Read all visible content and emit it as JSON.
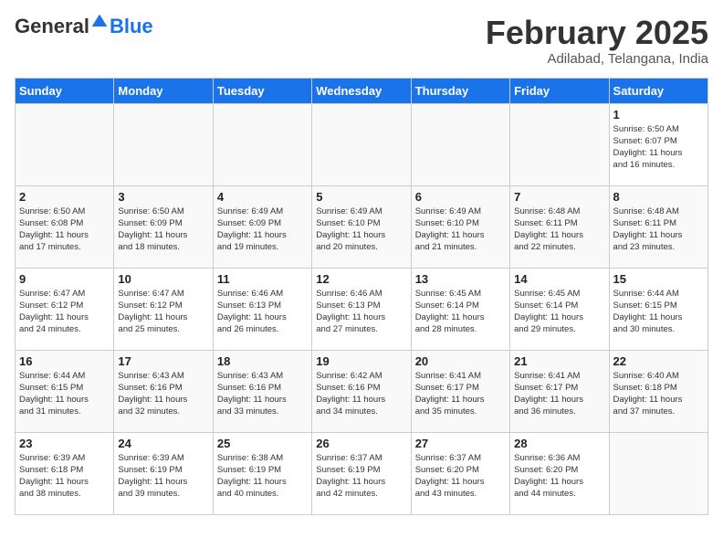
{
  "logo": {
    "general": "General",
    "blue": "Blue"
  },
  "title": "February 2025",
  "location": "Adilabad, Telangana, India",
  "days_of_week": [
    "Sunday",
    "Monday",
    "Tuesday",
    "Wednesday",
    "Thursday",
    "Friday",
    "Saturday"
  ],
  "weeks": [
    [
      {
        "day": "",
        "info": ""
      },
      {
        "day": "",
        "info": ""
      },
      {
        "day": "",
        "info": ""
      },
      {
        "day": "",
        "info": ""
      },
      {
        "day": "",
        "info": ""
      },
      {
        "day": "",
        "info": ""
      },
      {
        "day": "1",
        "info": "Sunrise: 6:50 AM\nSunset: 6:07 PM\nDaylight: 11 hours\nand 16 minutes."
      }
    ],
    [
      {
        "day": "2",
        "info": "Sunrise: 6:50 AM\nSunset: 6:08 PM\nDaylight: 11 hours\nand 17 minutes."
      },
      {
        "day": "3",
        "info": "Sunrise: 6:50 AM\nSunset: 6:09 PM\nDaylight: 11 hours\nand 18 minutes."
      },
      {
        "day": "4",
        "info": "Sunrise: 6:49 AM\nSunset: 6:09 PM\nDaylight: 11 hours\nand 19 minutes."
      },
      {
        "day": "5",
        "info": "Sunrise: 6:49 AM\nSunset: 6:10 PM\nDaylight: 11 hours\nand 20 minutes."
      },
      {
        "day": "6",
        "info": "Sunrise: 6:49 AM\nSunset: 6:10 PM\nDaylight: 11 hours\nand 21 minutes."
      },
      {
        "day": "7",
        "info": "Sunrise: 6:48 AM\nSunset: 6:11 PM\nDaylight: 11 hours\nand 22 minutes."
      },
      {
        "day": "8",
        "info": "Sunrise: 6:48 AM\nSunset: 6:11 PM\nDaylight: 11 hours\nand 23 minutes."
      }
    ],
    [
      {
        "day": "9",
        "info": "Sunrise: 6:47 AM\nSunset: 6:12 PM\nDaylight: 11 hours\nand 24 minutes."
      },
      {
        "day": "10",
        "info": "Sunrise: 6:47 AM\nSunset: 6:12 PM\nDaylight: 11 hours\nand 25 minutes."
      },
      {
        "day": "11",
        "info": "Sunrise: 6:46 AM\nSunset: 6:13 PM\nDaylight: 11 hours\nand 26 minutes."
      },
      {
        "day": "12",
        "info": "Sunrise: 6:46 AM\nSunset: 6:13 PM\nDaylight: 11 hours\nand 27 minutes."
      },
      {
        "day": "13",
        "info": "Sunrise: 6:45 AM\nSunset: 6:14 PM\nDaylight: 11 hours\nand 28 minutes."
      },
      {
        "day": "14",
        "info": "Sunrise: 6:45 AM\nSunset: 6:14 PM\nDaylight: 11 hours\nand 29 minutes."
      },
      {
        "day": "15",
        "info": "Sunrise: 6:44 AM\nSunset: 6:15 PM\nDaylight: 11 hours\nand 30 minutes."
      }
    ],
    [
      {
        "day": "16",
        "info": "Sunrise: 6:44 AM\nSunset: 6:15 PM\nDaylight: 11 hours\nand 31 minutes."
      },
      {
        "day": "17",
        "info": "Sunrise: 6:43 AM\nSunset: 6:16 PM\nDaylight: 11 hours\nand 32 minutes."
      },
      {
        "day": "18",
        "info": "Sunrise: 6:43 AM\nSunset: 6:16 PM\nDaylight: 11 hours\nand 33 minutes."
      },
      {
        "day": "19",
        "info": "Sunrise: 6:42 AM\nSunset: 6:16 PM\nDaylight: 11 hours\nand 34 minutes."
      },
      {
        "day": "20",
        "info": "Sunrise: 6:41 AM\nSunset: 6:17 PM\nDaylight: 11 hours\nand 35 minutes."
      },
      {
        "day": "21",
        "info": "Sunrise: 6:41 AM\nSunset: 6:17 PM\nDaylight: 11 hours\nand 36 minutes."
      },
      {
        "day": "22",
        "info": "Sunrise: 6:40 AM\nSunset: 6:18 PM\nDaylight: 11 hours\nand 37 minutes."
      }
    ],
    [
      {
        "day": "23",
        "info": "Sunrise: 6:39 AM\nSunset: 6:18 PM\nDaylight: 11 hours\nand 38 minutes."
      },
      {
        "day": "24",
        "info": "Sunrise: 6:39 AM\nSunset: 6:19 PM\nDaylight: 11 hours\nand 39 minutes."
      },
      {
        "day": "25",
        "info": "Sunrise: 6:38 AM\nSunset: 6:19 PM\nDaylight: 11 hours\nand 40 minutes."
      },
      {
        "day": "26",
        "info": "Sunrise: 6:37 AM\nSunset: 6:19 PM\nDaylight: 11 hours\nand 42 minutes."
      },
      {
        "day": "27",
        "info": "Sunrise: 6:37 AM\nSunset: 6:20 PM\nDaylight: 11 hours\nand 43 minutes."
      },
      {
        "day": "28",
        "info": "Sunrise: 6:36 AM\nSunset: 6:20 PM\nDaylight: 11 hours\nand 44 minutes."
      },
      {
        "day": "",
        "info": ""
      }
    ]
  ]
}
